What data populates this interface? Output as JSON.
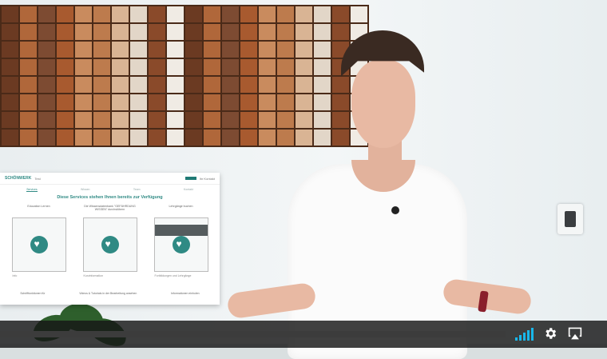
{
  "overlay": {
    "brand": "SCHÖNWERK",
    "brand_sub": "Test",
    "nav_right": "Ihr Kontakt",
    "tabs": [
      "Services",
      "Wissen",
      "Team",
      "Kontakt"
    ],
    "heading": "Diese Services stehen Ihnen bereits zur Verfügung",
    "columns": [
      "Education Lernen",
      "Die Wissensdatenbank \"GEFÄHRDUNG WISSEN\" durchstöbern",
      "Lehrgänge buchen"
    ],
    "thumb_labels": [
      "Info",
      "Kurzinformation",
      "Fortbildungen und Lehrgänge"
    ],
    "footer": [
      "Schriftfunktionen für",
      "Videos & Tutorials in der Bearbeitung ansehen",
      "Informationen einholen"
    ]
  },
  "controls": {
    "progress_fraction": 0,
    "volume_level": 5,
    "settings_icon": "gear-icon",
    "airplay_icon": "airplay-icon",
    "accent_color": "#19b7ea"
  }
}
